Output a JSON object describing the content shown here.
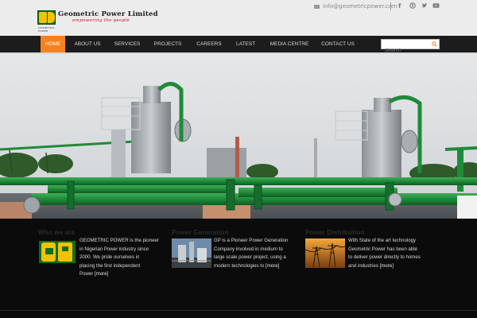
{
  "header": {
    "company_name": "Geometric Power Limited",
    "tagline": "empowering the people",
    "logo_subtext": "GEOMETRIC POWER",
    "email": "info@geometricpower.com",
    "social_icons": [
      "facebook-icon",
      "skype-icon",
      "twitter-icon",
      "youtube-icon"
    ]
  },
  "nav": {
    "items": [
      {
        "label": "HOME",
        "active": true
      },
      {
        "label": "ABOUT US",
        "active": false
      },
      {
        "label": "SERVICES",
        "active": false
      },
      {
        "label": "PROJECTS",
        "active": false
      },
      {
        "label": "CAREERS",
        "active": false
      },
      {
        "label": "LATEST",
        "active": false
      },
      {
        "label": "MEDIA CENTRE",
        "active": false
      },
      {
        "label": "CONTACT US",
        "active": false
      }
    ],
    "search_placeholder": "Search"
  },
  "sections": [
    {
      "title": "Who we are",
      "lines": [
        "GEOMETRIC POWER is the pioneer",
        "in Nigerian Power industry since",
        "2000. We pride ourselves in",
        "placing the first independent",
        "Power "
      ],
      "more": "[more]"
    },
    {
      "title": "Power Generation",
      "lines": [
        "GP is a Pioneer Power Generation",
        "Company involved in medium to",
        "large scale power project, using a",
        "modern technologies to "
      ],
      "more": "[more]"
    },
    {
      "title": "Power Distribution",
      "lines": [
        "With State of the art technology",
        "Geometric Power has been able",
        "to deliver power directly to homes",
        "and industries "
      ],
      "more": "[more]"
    }
  ],
  "colors": {
    "accent": "#f58220",
    "nav_bg": "#1c1c1c",
    "pipe_green": "#1f8a3a",
    "tagline_red": "#c8102e"
  }
}
